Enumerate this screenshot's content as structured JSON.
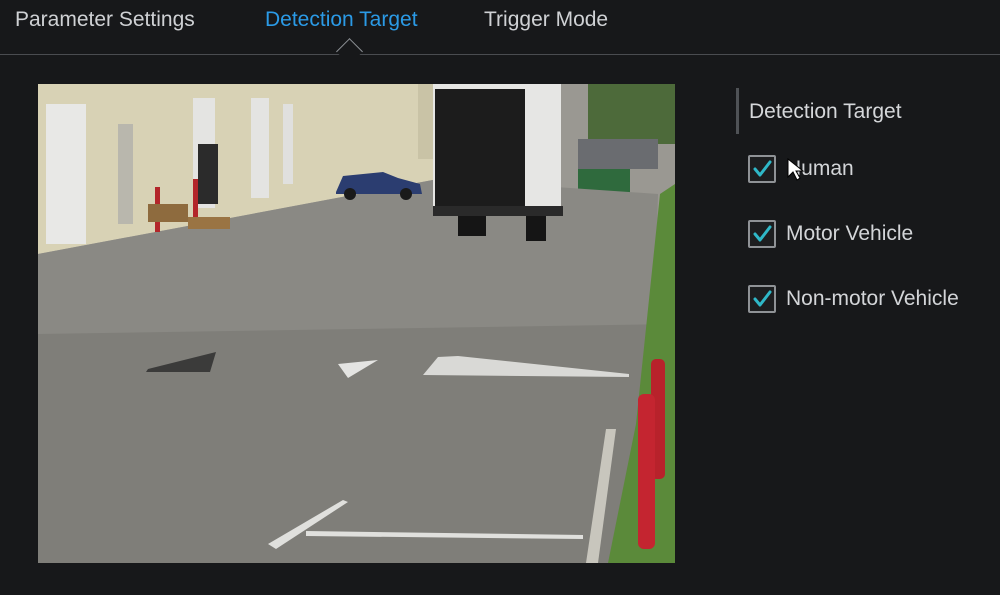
{
  "tabs": [
    {
      "label": "Parameter Settings",
      "active": false
    },
    {
      "label": "Detection Target",
      "active": true
    },
    {
      "label": "Trigger Mode",
      "active": false
    }
  ],
  "panel": {
    "title": "Detection Target",
    "options": [
      {
        "label": "Human",
        "checked": true
      },
      {
        "label": "Motor Vehicle",
        "checked": true
      },
      {
        "label": "Non-motor Vehicle",
        "checked": true
      }
    ]
  },
  "colors": {
    "accent": "#2b9ae6",
    "check": "#2fb8c8",
    "background": "#17181a"
  },
  "icons": [
    "checkbox-checked-icon",
    "mouse-cursor-icon"
  ]
}
